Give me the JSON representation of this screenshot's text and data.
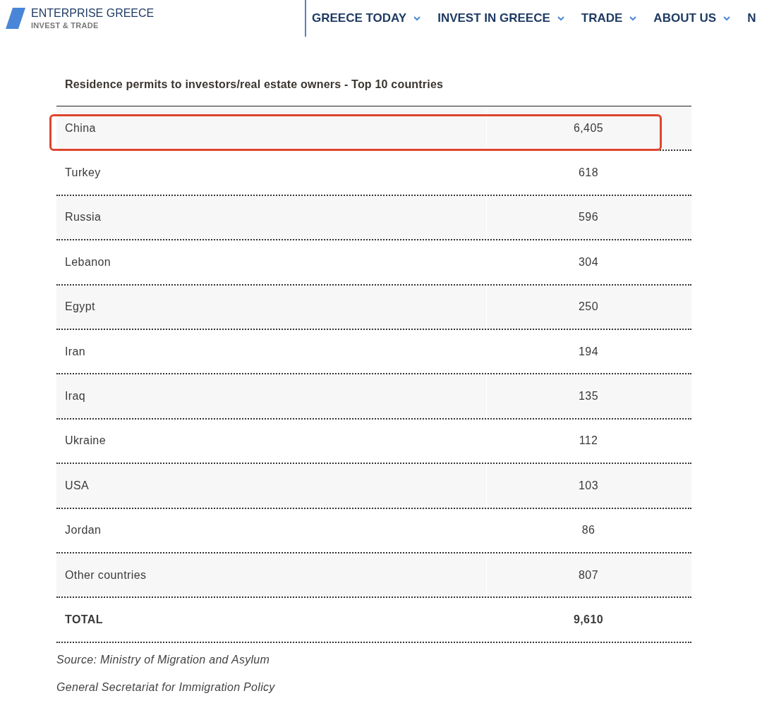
{
  "header": {
    "logo_title": "ENTERPRISE GREECE",
    "logo_subtitle": "INVEST & TRADE",
    "nav": [
      {
        "label": "GREECE TODAY",
        "dropdown": true
      },
      {
        "label": "INVEST IN GREECE",
        "dropdown": true
      },
      {
        "label": "TRADE",
        "dropdown": true
      },
      {
        "label": "ABOUT US",
        "dropdown": true
      },
      {
        "label": "N",
        "dropdown": false
      }
    ]
  },
  "table": {
    "title": "Residence permits to investors/real estate owners - Top 10 countries",
    "rows": [
      {
        "country": "China",
        "value": "6,405",
        "highlighted": true
      },
      {
        "country": "Turkey",
        "value": "618",
        "highlighted": false
      },
      {
        "country": "Russia",
        "value": "596",
        "highlighted": false
      },
      {
        "country": "Lebanon",
        "value": "304",
        "highlighted": false
      },
      {
        "country": "Egypt",
        "value": "250",
        "highlighted": false
      },
      {
        "country": "Iran",
        "value": "194",
        "highlighted": false
      },
      {
        "country": "Iraq",
        "value": "135",
        "highlighted": false
      },
      {
        "country": "Ukraine",
        "value": "112",
        "highlighted": false
      },
      {
        "country": "USA",
        "value": "103",
        "highlighted": false
      },
      {
        "country": "Jordan",
        "value": "86",
        "highlighted": false
      },
      {
        "country": "Other countries",
        "value": "807",
        "highlighted": false
      }
    ],
    "total": {
      "label": "TOTAL",
      "value": "9,610"
    }
  },
  "sources": [
    "Source: Ministry of Migration and Asylum",
    "General Secretariat for Immigration Policy"
  ]
}
